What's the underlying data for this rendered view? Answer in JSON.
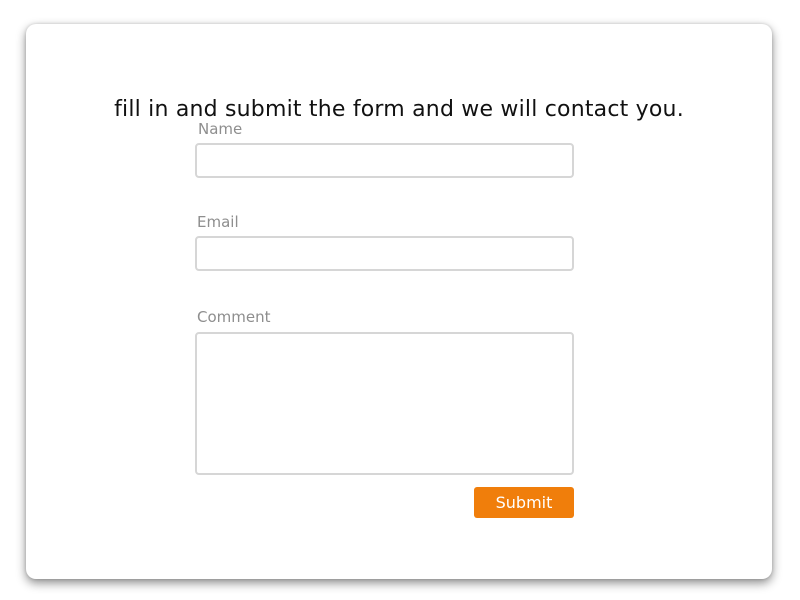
{
  "form": {
    "headline": "fill in and submit the form and we will contact you.",
    "name_label": "Name",
    "name_value": "",
    "email_label": "Email",
    "email_value": "",
    "comment_label": "Comment",
    "comment_value": "",
    "submit_label": "Submit"
  },
  "colors": {
    "accent": "#f07e0b",
    "label": "#8e8e8e",
    "input_border": "#d6d6d6",
    "headline": "#111111"
  }
}
